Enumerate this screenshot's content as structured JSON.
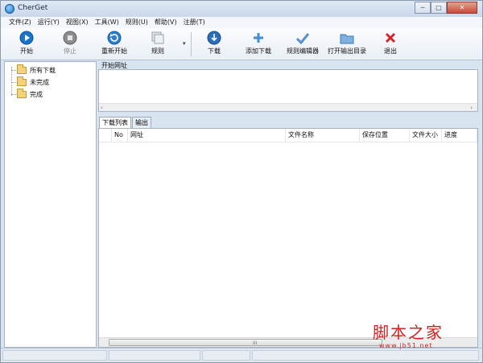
{
  "window": {
    "title": "CherGet",
    "min_glyph": "─",
    "max_glyph": "□",
    "close_glyph": "✕"
  },
  "menu": [
    {
      "label": "文件(Z)"
    },
    {
      "label": "运行(Y)"
    },
    {
      "label": "视图(X)"
    },
    {
      "label": "工具(W)"
    },
    {
      "label": "规则(U)"
    },
    {
      "label": "帮助(V)"
    },
    {
      "label": "注册(T)"
    }
  ],
  "toolbar": {
    "start": "开始",
    "stop": "停止",
    "restart": "重新开始",
    "rule": "规则",
    "rule_dropdown": "▾",
    "download": "下载",
    "add_download": "添加下载",
    "rule_editor": "规则编辑器",
    "open_output": "打开输出目录",
    "exit": "退出"
  },
  "tree": {
    "items": [
      {
        "label": "所有下载"
      },
      {
        "label": "未完成"
      },
      {
        "label": "完成"
      }
    ]
  },
  "url_panel": {
    "label": "开始网址",
    "scroll_left": "‹",
    "scroll_right": "›"
  },
  "tabs": [
    {
      "label": "下载列表",
      "active": true
    },
    {
      "label": "输出",
      "active": false
    }
  ],
  "list": {
    "columns": [
      "No",
      "网址",
      "文件名称",
      "保存位置",
      "文件大小",
      "进度"
    ],
    "rows": [],
    "scroll_grip": "III"
  },
  "watermark": {
    "text": "脚本之家",
    "url": "www.jb51.net"
  },
  "colors": {
    "accent_blue": "#1a74c9",
    "exit_red": "#d0282a",
    "folder": "#f4d27a",
    "watermark": "#d02020"
  }
}
